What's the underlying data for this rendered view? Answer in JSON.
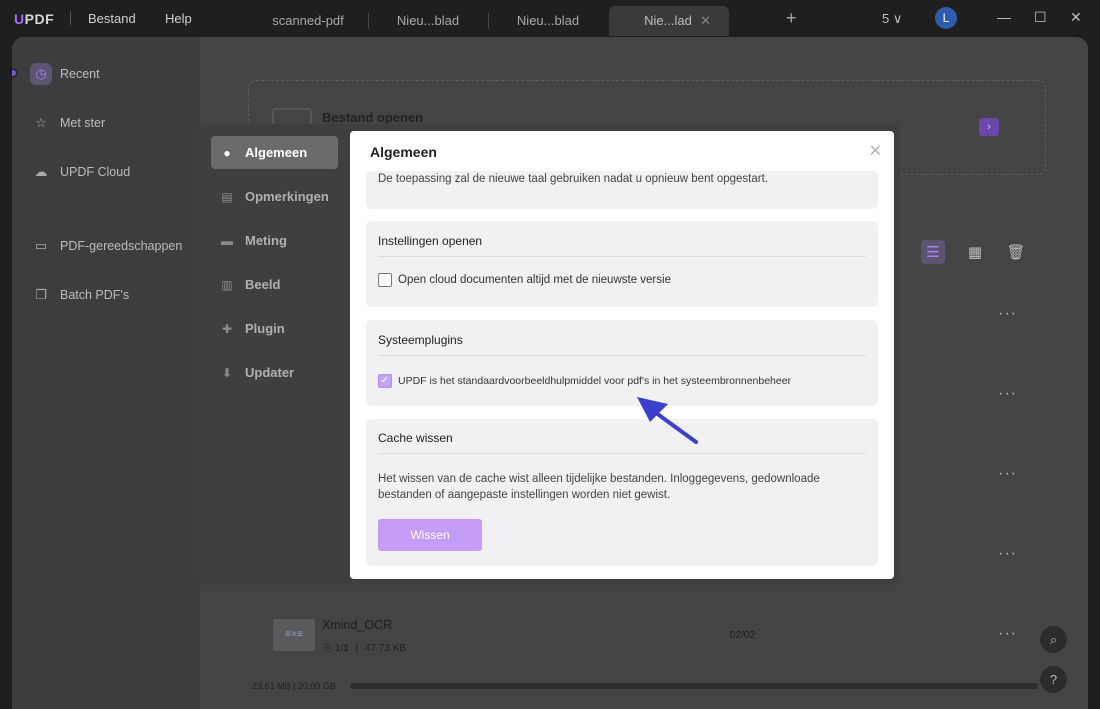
{
  "titlebar": {
    "logo_u": "U",
    "logo_rest": "PDF",
    "menu": [
      "Bestand",
      "Help"
    ],
    "tabs": [
      "scanned-pdf",
      "Nieu...blad",
      "Nieu...blad",
      "Nie...lad"
    ],
    "window_count": "5 ∨",
    "avatar_letter": "L",
    "tab_close": "✕",
    "plus": "+",
    "minimize": "—",
    "maximize": "☐",
    "close": "✕"
  },
  "leftnav": {
    "items": [
      {
        "label": "Recent",
        "icon": "clock-icon"
      },
      {
        "label": "Met ster",
        "icon": "star-icon"
      },
      {
        "label": "UPDF Cloud",
        "icon": "cloud-icon"
      },
      {
        "label": "PDF-gereedschappen",
        "icon": "toolbox-icon"
      },
      {
        "label": "Batch PDF's",
        "icon": "batch-icon"
      }
    ]
  },
  "home": {
    "open_title": "Bestand openen",
    "file_name": "Xmind_OCR",
    "file_pages": "1/1",
    "file_size": "47.73 KB",
    "file_date": "02/02",
    "storage": "23.61 MB | 20.00 GB"
  },
  "dialog": {
    "sidebar": [
      "Algemeen",
      "Opmerkingen",
      "Meting",
      "Beeld",
      "Plugin",
      "Updater"
    ],
    "title": "Algemeen",
    "language_note": "De toepassing zal de nieuwe taal gebruiken nadat u opnieuw bent opgestart.",
    "open_settings": {
      "title": "Instellingen openen",
      "checkbox_label": "Open cloud documenten altijd met de nieuwste versie",
      "checked": false
    },
    "system_plugins": {
      "title": "Systeemplugins",
      "checkbox_label": "UPDF is het standaardvoorbeeldhulpmiddel voor pdf's in het systeembronnenbeheer",
      "checked": true
    },
    "cache": {
      "title": "Cache wissen",
      "description": "Het wissen van de cache wist alleen tijdelijke bestanden. Inloggegevens, gedownloade bestanden of aangepaste instellingen worden niet gewist.",
      "button": "Wissen"
    }
  },
  "colors": {
    "accent": "#a66cff",
    "button": "#c69cf9",
    "annotation_arrow": "#3a3fce"
  }
}
